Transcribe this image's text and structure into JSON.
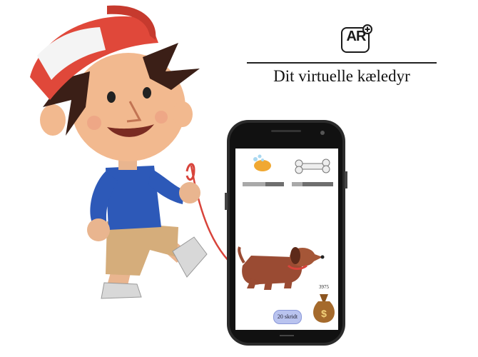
{
  "logo": {
    "text": "AR"
  },
  "header": {
    "title": "Dit virtuelle kæledyr"
  },
  "app": {
    "steps_button": "20 skridt",
    "money": "3975",
    "bars": [
      {
        "name": "hygiene",
        "level": 0.55
      },
      {
        "name": "food",
        "level": 0.25
      }
    ]
  },
  "colors": {
    "cap_red": "#e0483a",
    "shirt_blue": "#2d59b8",
    "phone_body": "#2b2b2b",
    "dog_brown": "#9a4b33"
  },
  "icons": [
    "ar-plus-logo-icon",
    "soap-sponge-icon",
    "bone-icon",
    "dog-icon",
    "money-bag-icon"
  ]
}
